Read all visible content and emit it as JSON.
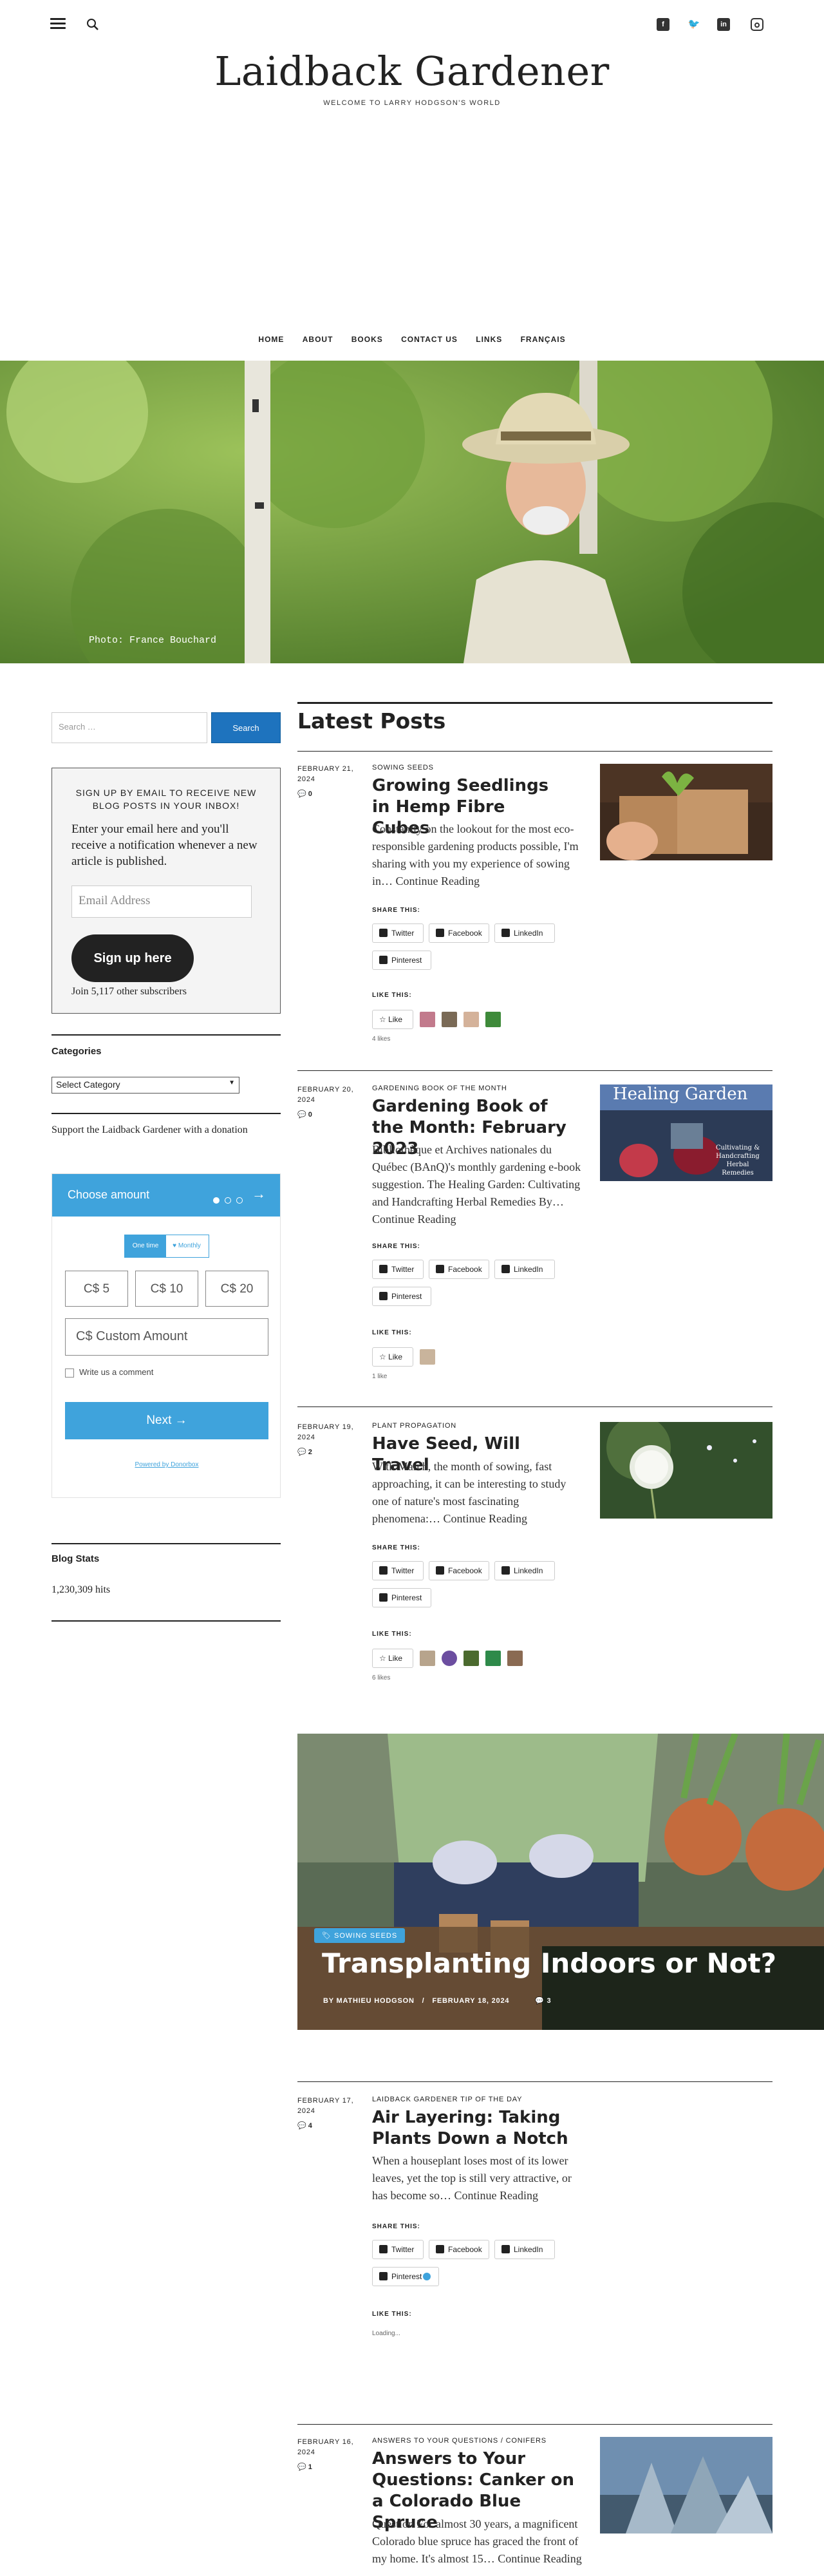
{
  "header": {
    "title": "Laidback Gardener",
    "tagline": "WELCOME TO LARRY HODGSON'S WORLD",
    "social": [
      "facebook-icon",
      "twitter-icon",
      "linkedin-icon",
      "instagram-icon"
    ]
  },
  "nav": [
    "HOME",
    "ABOUT",
    "BOOKS",
    "CONTACT US",
    "LINKS",
    "FRANÇAIS"
  ],
  "hero": {
    "caption": "Photo: France Bouchard"
  },
  "sidebar": {
    "search_placeholder": "Search …",
    "search_button": "Search",
    "subscribe_heading": "SIGN UP BY EMAIL TO RECEIVE NEW BLOG POSTS IN YOUR INBOX!",
    "subscribe_text": "Enter your email here and you'll receive a notification whenever a new article is published.",
    "email_placeholder": "Email Address",
    "signup_button": "Sign up here",
    "subscribers": "Join 5,117 other subscribers",
    "categories_title": "Categories",
    "categories_select": "Select Category",
    "support_text": "Support the Laidback Gardener with a donation",
    "donate": {
      "heading": "Choose amount",
      "one_time": "One time",
      "monthly": "♥ Monthly",
      "amounts": [
        "C$ 5",
        "C$ 10",
        "C$ 20"
      ],
      "custom": "C$ Custom Amount",
      "comment": "Write us a comment",
      "next": "Next",
      "powered": "Powered by Donorbox"
    },
    "stats_title": "Blog Stats",
    "stats_value": "1,230,309 hits"
  },
  "main": {
    "heading": "Latest Posts",
    "share_label": "SHARE THIS:",
    "like_label": "LIKE THIS:",
    "buttons": {
      "twitter": "Twitter",
      "facebook": "Facebook",
      "linkedin": "LinkedIn",
      "pinterest": "Pinterest",
      "like": "Like"
    },
    "loading": "Loading...",
    "posts": [
      {
        "date": "FEBRUARY 21, 2024",
        "comments": "0",
        "category": "SOWING SEEDS",
        "title": "Growing Seedlings in Hemp Fibre Cubes",
        "excerpt": "Constantly on the lookout for the most eco-responsible gardening products possible, I'm sharing with you my experience of sowing in… Continue Reading",
        "likes": "4 likes"
      },
      {
        "date": "FEBRUARY 20, 2024",
        "comments": "0",
        "category": "GARDENING BOOK OF THE MONTH",
        "title": "Gardening Book of the Month: February 2023",
        "excerpt": "Bibliothèque et Archives nationales du Québec (BAnQ)'s monthly gardening e-book suggestion. The Healing Garden: Cultivating and Handcrafting Herbal Remedies By… Continue Reading",
        "likes": "1 like",
        "thumb_title": "Healing Garden",
        "thumb_sub": "Cultivating & Handcrafting Herbal Remedies"
      },
      {
        "date": "FEBRUARY 19, 2024",
        "comments": "2",
        "category": "PLANT PROPAGATION",
        "title": "Have Seed, Will Travel",
        "excerpt": "With March, the month of sowing, fast approaching, it can be interesting to study one of nature's most fascinating phenomena:… Continue Reading",
        "likes": "6 likes"
      },
      {
        "date": "FEBRUARY 17, 2024",
        "comments": "4",
        "category": "LAIDBACK GARDENER TIP OF THE DAY",
        "title": "Air Layering: Taking Plants Down a Notch",
        "excerpt": "When a houseplant loses most of its lower leaves, yet the top is still very attractive, or has become so… Continue Reading"
      },
      {
        "date": "FEBRUARY 16, 2024",
        "comments": "1",
        "category": "ANSWERS TO YOUR QUESTIONS / CONIFERS",
        "title": "Answers to Your Questions: Canker on a Colorado Blue Spruce",
        "excerpt": "Question For almost 30 years, a magnificent Colorado blue spruce has graced the front of my home. It's almost 15… Continue Reading"
      }
    ],
    "feature": {
      "badge": "SOWING SEEDS",
      "title": "Transplanting Indoors or Not?",
      "author": "BY MATHIEU HODGSON",
      "date": "FEBRUARY 18, 2024",
      "comments": "3"
    }
  }
}
